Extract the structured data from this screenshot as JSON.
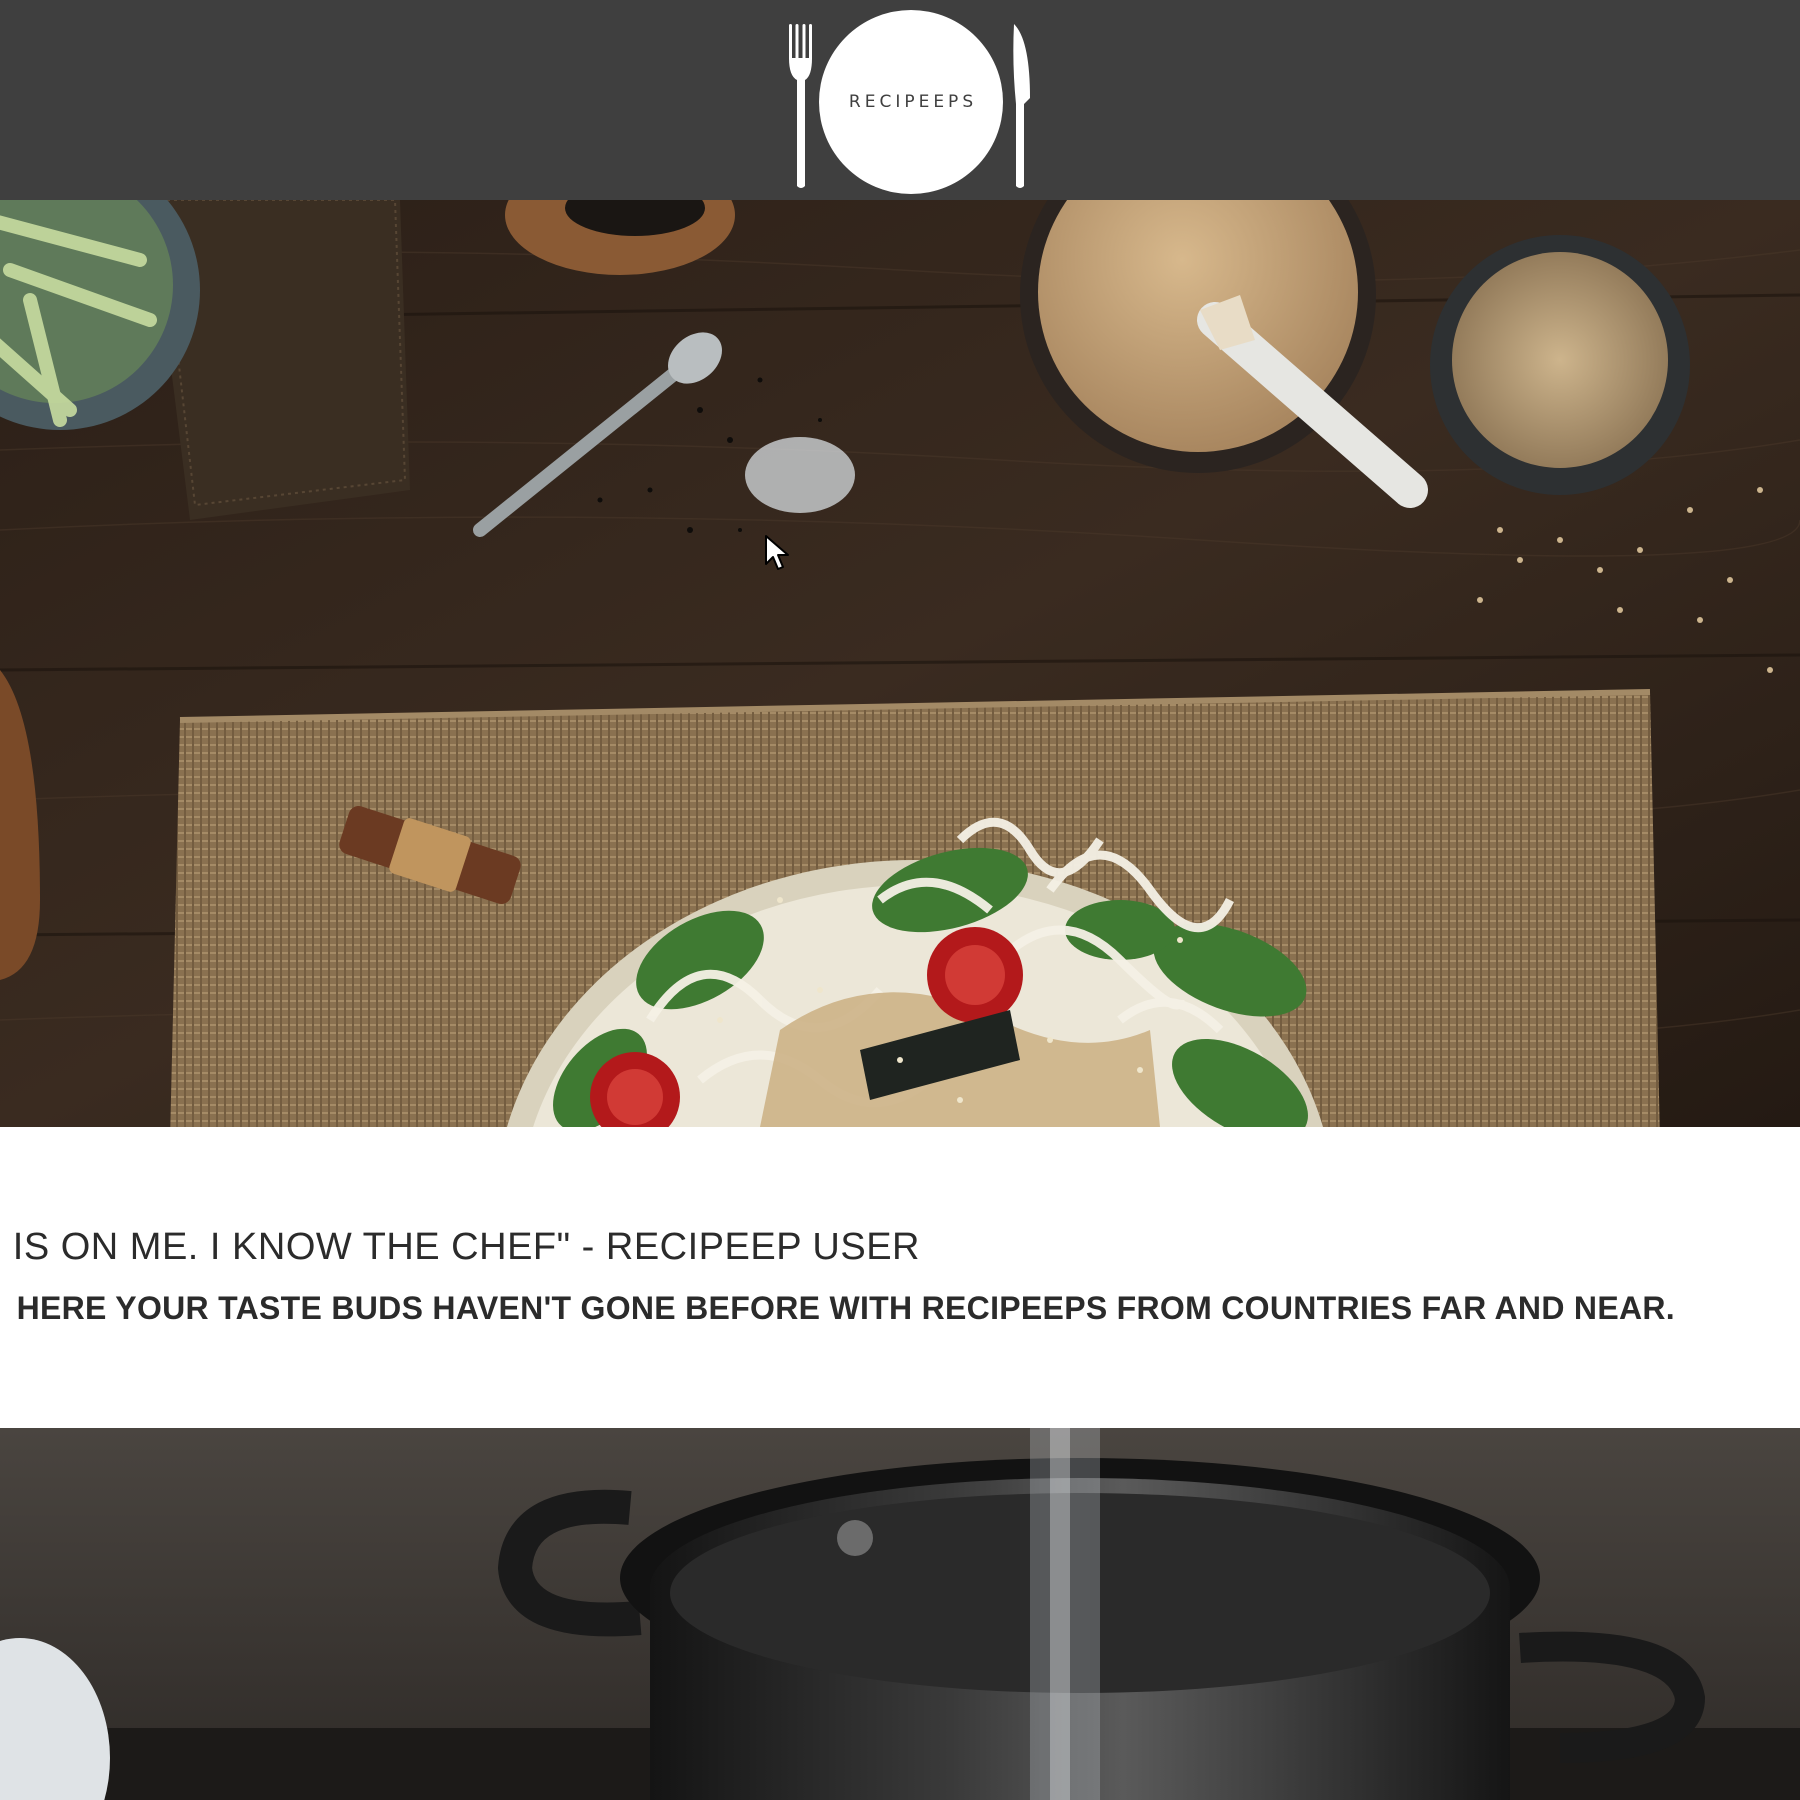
{
  "header": {
    "brand": "RECIPEEPS",
    "background_color": "#3f3f3f",
    "logo_icons": [
      "fork-icon",
      "plate-icon",
      "knife-icon"
    ]
  },
  "hero": {
    "image": "overhead-noodle-salad-photo",
    "subjects": [
      "noodle-salad-plate",
      "burlap-placemat",
      "sesame-sauce-jar",
      "sesame-seed-bowl",
      "salt-spoon",
      "chopstick-rest",
      "cucumber-bowl"
    ]
  },
  "quote_band": {
    "quote": "NER IS ON ME. I KNOW THE CHEF\" - RECIPEEP USER",
    "tagline": "HERE YOUR TASTE BUDS HAVEN'T GONE BEFORE WITH RECIPEEPS FROM COUNTRIES FAR AND NEAR."
  },
  "pot_section": {
    "image": "cooking-pot-photo"
  },
  "colors": {
    "text": "#2b2b2b",
    "background": "#ffffff"
  },
  "cursor": {
    "icon": "arrow-cursor-icon"
  }
}
